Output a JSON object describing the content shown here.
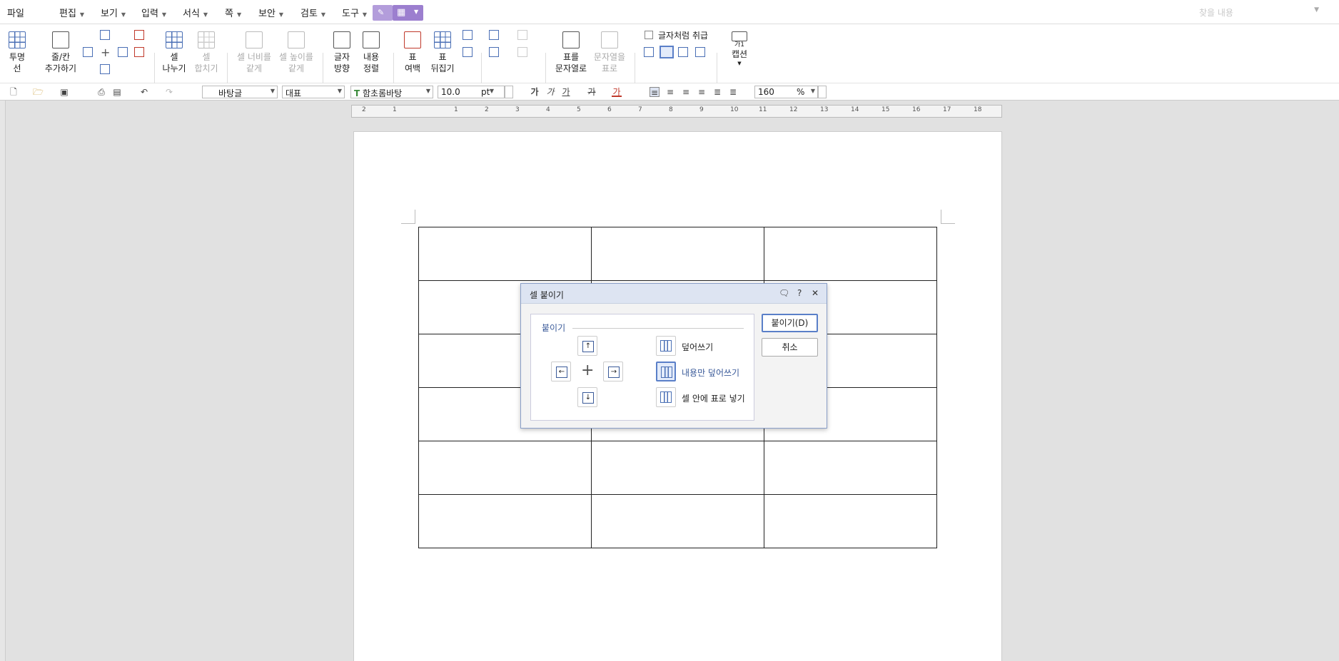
{
  "menubar": {
    "items": [
      "파일",
      "편집",
      "보기",
      "입력",
      "서식",
      "쪽",
      "보안",
      "검토",
      "도구"
    ],
    "search_placeholder": "찾을 내용"
  },
  "ribbon": {
    "buttons": [
      {
        "label": "투명\n선",
        "enabled": true
      },
      {
        "label": "줄/칸\n추가하기",
        "enabled": true
      },
      {
        "label": "셀\n나누기",
        "enabled": true
      },
      {
        "label": "셀\n합치기",
        "enabled": false
      },
      {
        "label": "셀 너비를\n같게",
        "enabled": false
      },
      {
        "label": "셀 높이를\n같게",
        "enabled": false
      },
      {
        "label": "글자\n방향",
        "enabled": true
      },
      {
        "label": "내용\n정렬",
        "enabled": true
      },
      {
        "label": "표\n여백",
        "enabled": true
      },
      {
        "label": "표\n뒤집기",
        "enabled": true
      },
      {
        "label": "표를\n문자열로",
        "enabled": true
      },
      {
        "label": "문자열을\n표로",
        "enabled": false
      },
      {
        "label": "캡션",
        "enabled": true
      }
    ],
    "checkbox_label": "글자처럼 취급",
    "caption_icon_text": "가1"
  },
  "toolbar": {
    "style": "바탕글",
    "lang": "대표",
    "font": "함초롬바탕",
    "size": "10.0",
    "size_unit": "pt",
    "zoom": "160",
    "zoom_unit": "%",
    "format_glyphs": [
      "가",
      "가",
      "가",
      "가",
      "가"
    ]
  },
  "ruler": {
    "labels": [
      "2",
      "1",
      "1",
      "2",
      "3",
      "4",
      "5",
      "6",
      "7",
      "8",
      "9",
      "10",
      "11",
      "12",
      "13",
      "14",
      "15",
      "16",
      "17",
      "18"
    ]
  },
  "dialog": {
    "title": "셀 붙이기",
    "group_label": "붙이기",
    "options": [
      "덮어쓰기",
      "내용만 덮어쓰기",
      "셀 안에 표로 넣기"
    ],
    "selected_option": 1,
    "ok_label": "붙이기(D)",
    "cancel_label": "취소"
  }
}
